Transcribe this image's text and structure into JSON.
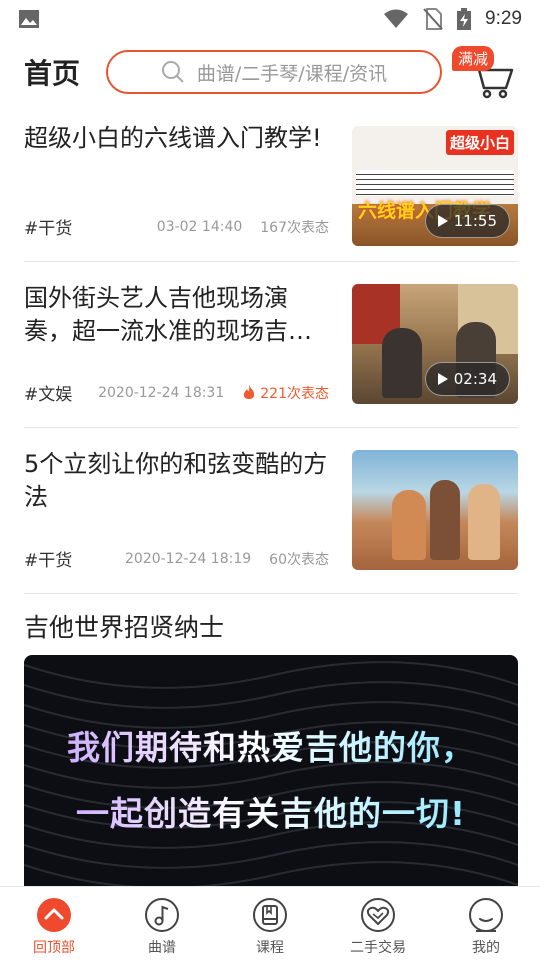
{
  "status_bar": {
    "time": "9:29",
    "icons": [
      "image-icon",
      "wifi-icon",
      "no-sim-icon",
      "battery-charging-icon"
    ]
  },
  "header": {
    "title": "首页",
    "search_placeholder": "曲谱/二手琴/课程/资讯",
    "promo_badge": "满减",
    "accent": "#e8542f"
  },
  "articles": [
    {
      "title": "超级小白的六线谱入门教学!",
      "tag": "#干货",
      "date": "03-02 14:40",
      "reactions": "167次表态",
      "hot": false,
      "duration": "11:55",
      "thumb_caption_top": "超级小白",
      "thumb_caption_bottom": "六线谱入门教学"
    },
    {
      "title": "国外街头艺人吉他现场演奏，超一流水准的现场吉…",
      "tag": "#文娱",
      "date": "2020-12-24 18:31",
      "reactions": "221次表态",
      "hot": true,
      "duration": "02:34"
    },
    {
      "title": "5个立刻让你的和弦变酷的方法",
      "tag": "#干货",
      "date": "2020-12-24 18:19",
      "reactions": "60次表态",
      "hot": false
    }
  ],
  "recruit": {
    "title": "吉他世界招贤纳士",
    "line1": "我们期待和热爱吉他的你，",
    "line2": "一起创造有关吉他的一切!"
  },
  "bottom_nav": [
    {
      "label": "回顶部",
      "icon": "back-to-top-icon",
      "active": true
    },
    {
      "label": "曲谱",
      "icon": "music-note-icon",
      "active": false
    },
    {
      "label": "课程",
      "icon": "course-book-icon",
      "active": false
    },
    {
      "label": "二手交易",
      "icon": "trade-heart-icon",
      "active": false
    },
    {
      "label": "我的",
      "icon": "profile-face-icon",
      "active": false
    }
  ]
}
